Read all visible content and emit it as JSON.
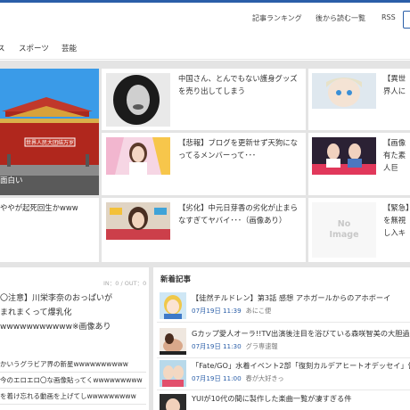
{
  "header": {
    "links": [
      {
        "label": "記事ランキング"
      },
      {
        "label": "後から読む一覧"
      },
      {
        "label": "RSS"
      }
    ]
  },
  "categories": [
    {
      "label": "ス"
    },
    {
      "label": "スポーツ"
    },
    {
      "label": "芸能"
    }
  ],
  "grid": {
    "cards": [
      {
        "title": "中国さん、とんでもない護身グッズを売り出してしまう"
      },
      {
        "title": "【異世界人には"
      },
      {
        "title": "面白い"
      },
      {
        "title": "【悲報】ブログを更新せず天狗になってるメンバーって･･･"
      },
      {
        "title": "【画像有た素人巨JKwwwwwwww"
      },
      {
        "title": "ややが起死回生かwww"
      },
      {
        "title": "【劣化】中元日芽香の劣化が止まらなすぎてヤバイ･･･（画像あり）"
      },
      {
        "title": "【緊急】を無視し入キター"
      }
    ],
    "flag_banner": "世界人民大团结万岁",
    "noimage": {
      "line1": "No",
      "line2": "Image"
    }
  },
  "featured": {
    "counter": "IN：0 / OUT：0",
    "lines": [
      "〇注意】川栄李奈のおっぱいが",
      "まれまくって爆乳化",
      "wwwwwwwwwww※画像あり"
    ],
    "links": [
      "かいうグラビア界の新星wwwwwwwwww",
      "今のエロエロ〇な画像貼ってくwwwwwwwww",
      "を着け忘れる動画を上げてしwwwwwwwww"
    ]
  },
  "new_articles": {
    "heading": "新着記事",
    "items": [
      {
        "title": "【徒然チルドレン】第3話 感想 アホガールからのアホボーイ",
        "date": "07月19日 11:39",
        "source": "あにこ便"
      },
      {
        "title": "Gカップ愛人オーラ!!TV出演後注目を浴びている森咲智美の大胆過",
        "date": "07月19日 11:30",
        "source": "グラ専速報"
      },
      {
        "title": "「Fate/GO」水着イベント2部「復刻カルデアヒートオデッセイ」告知以",
        "date": "07月19日 11:00",
        "source": "春が大好きっ"
      },
      {
        "title": "YUIが10代の間に製作した楽曲一覧が凄すぎる件",
        "date": "",
        "source": ""
      }
    ]
  }
}
